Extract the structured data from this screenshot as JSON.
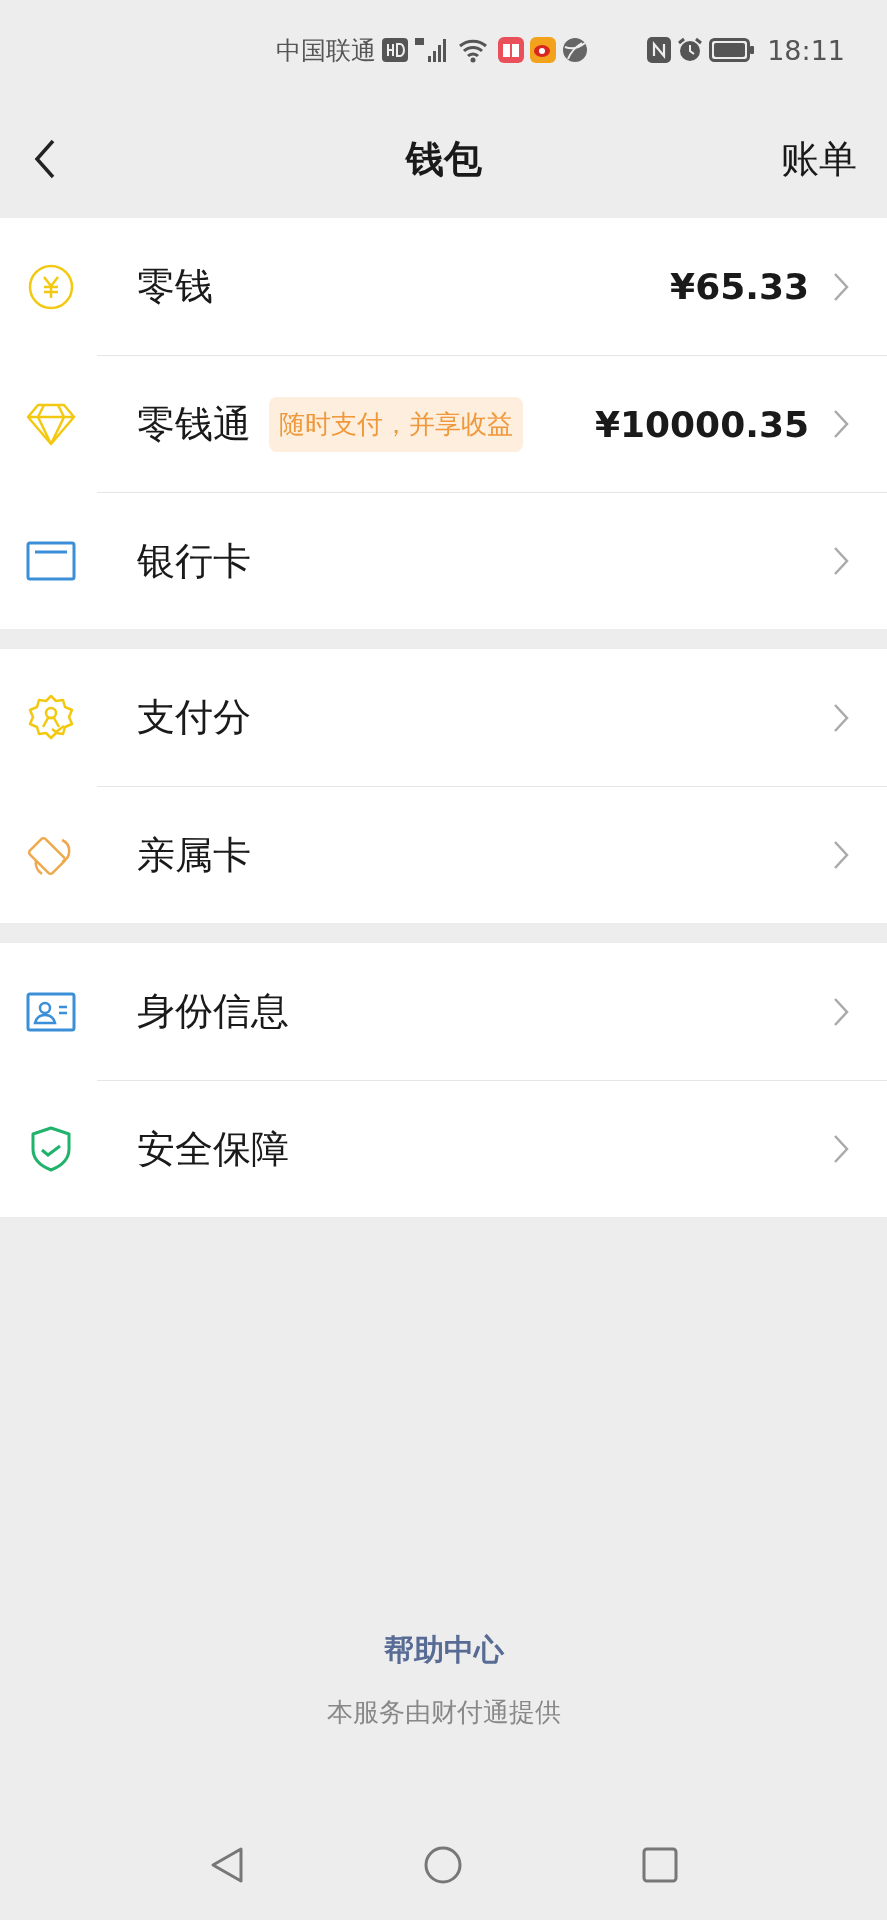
{
  "status_bar": {
    "carrier": "中国联通",
    "time": "18:11"
  },
  "header": {
    "title": "钱包",
    "action": "账单"
  },
  "sections": [
    {
      "items": [
        {
          "kind": "coin",
          "label": "零钱",
          "amount": "¥65.33"
        },
        {
          "kind": "diamond",
          "label": "零钱通",
          "tag": "随时支付，并享收益",
          "amount": "¥10000.35"
        },
        {
          "kind": "card",
          "label": "银行卡"
        }
      ]
    },
    {
      "items": [
        {
          "kind": "badge",
          "label": "支付分"
        },
        {
          "kind": "family",
          "label": "亲属卡"
        }
      ]
    },
    {
      "items": [
        {
          "kind": "id",
          "label": "身份信息"
        },
        {
          "kind": "shield",
          "label": "安全保障"
        }
      ]
    }
  ],
  "footer": {
    "link": "帮助中心",
    "note": "本服务由财付通提供"
  }
}
